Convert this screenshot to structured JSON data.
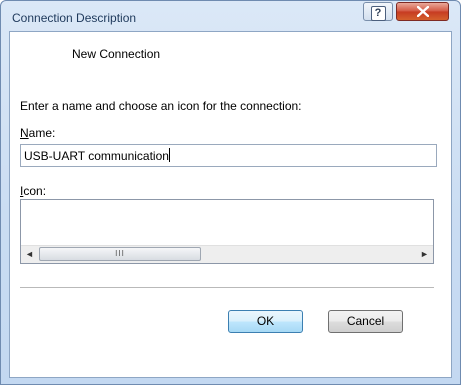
{
  "window": {
    "title": "Connection Description"
  },
  "titlebar_buttons": {
    "help": "?",
    "close_icon": "close-x-icon"
  },
  "dialog": {
    "header": "New Connection",
    "instruction": "Enter a name and choose an icon for the connection:",
    "name_label": "Name:",
    "name_value": "USB-UART communication",
    "icon_label": "Icon:"
  },
  "scrollbar": {
    "left_arrow": "◄",
    "right_arrow": "►",
    "thumb_grip": "III"
  },
  "buttons": {
    "ok": "OK",
    "cancel": "Cancel"
  },
  "colors": {
    "close_button": "#c63a22",
    "title_text": "#1e395b",
    "focused_button": "#3c7fb1"
  }
}
